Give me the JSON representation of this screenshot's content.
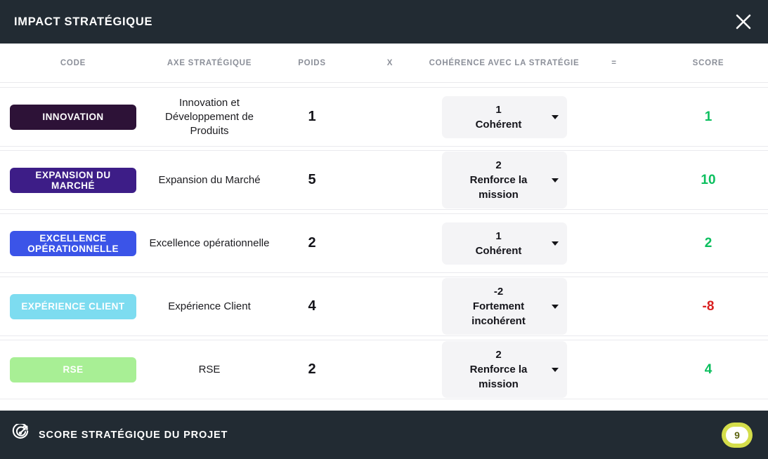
{
  "header": {
    "title": "IMPACT STRATÉGIQUE",
    "close_icon": "close-icon"
  },
  "columns": {
    "code": "CODE",
    "axe": "AXE STRATÉGIQUE",
    "poids": "POIDS",
    "multiply": "X",
    "coherence": "COHÉRENCE AVEC LA STRATÉGIE",
    "equals": "=",
    "score": "SCORE"
  },
  "colors": {
    "header_bg": "#222b33",
    "score_positive": "#0bbf5e",
    "score_negative": "#d92020",
    "total_pill": "#d4dd4a"
  },
  "rows": [
    {
      "code": "INNOVATION",
      "code_color": "#2d1237",
      "axe": "Innovation et Développement de Produits",
      "poids": "1",
      "coherence_value": "1",
      "coherence_label": "Cohérent",
      "score": "1",
      "score_color": "#0bbf5e"
    },
    {
      "code": "EXPANSION DU MARCHÉ",
      "code_color": "#3d1d87",
      "axe": "Expansion du Marché",
      "poids": "5",
      "coherence_value": "2",
      "coherence_label": "Renforce la mission",
      "score": "10",
      "score_color": "#0bbf5e"
    },
    {
      "code": "EXCELLENCE OPÉRATIONNELLE",
      "code_color": "#3b54e8",
      "axe": "Excellence opérationnelle",
      "poids": "2",
      "coherence_value": "1",
      "coherence_label": "Cohérent",
      "score": "2",
      "score_color": "#0bbf5e"
    },
    {
      "code": "EXPÉRIENCE CLIENT",
      "code_color": "#7ddcf0",
      "axe": "Expérience Client",
      "poids": "4",
      "coherence_value": "-2",
      "coherence_label": "Fortement incohérent",
      "score": "-8",
      "score_color": "#d92020"
    },
    {
      "code": "RSE",
      "code_color": "#a8ef95",
      "axe": "RSE",
      "poids": "2",
      "coherence_value": "2",
      "coherence_label": "Renforce la mission",
      "score": "4",
      "score_color": "#0bbf5e"
    }
  ],
  "footer": {
    "icon": "target-icon",
    "label": "SCORE STRATÉGIQUE DU PROJET",
    "total": "9"
  }
}
